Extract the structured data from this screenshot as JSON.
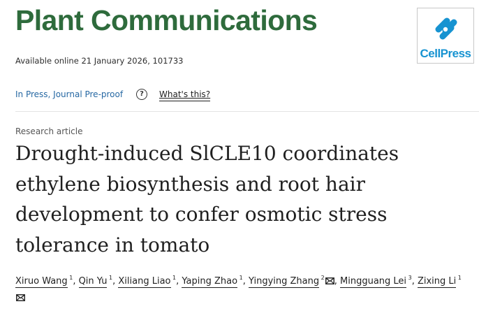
{
  "journal": {
    "name": "Plant Communications"
  },
  "publisher": {
    "logo_text": "CellPress",
    "logo_color": "#1793d1"
  },
  "article": {
    "availability": "Available online 21 January 2026, 101733",
    "press_status": "In Press, Journal Pre-proof",
    "help_icon_glyph": "?",
    "whats_this": "What's this?",
    "type": "Research article",
    "title": "Drought-induced SlCLE10 coordinates ethylene biosynthesis and root hair development to confer osmotic stress tolerance in tomato"
  },
  "authors": [
    {
      "name": "Xiruo Wang",
      "affil": "1",
      "email": false,
      "sep": ", "
    },
    {
      "name": "Qin Yu",
      "affil": "1",
      "email": false,
      "sep": ", "
    },
    {
      "name": "Xiliang Liao",
      "affil": "1",
      "email": false,
      "sep": ", "
    },
    {
      "name": "Yaping Zhao",
      "affil": "1",
      "email": false,
      "sep": ", "
    },
    {
      "name": "Yingying Zhang",
      "affil": "2",
      "email": true,
      "sep": ", "
    },
    {
      "name": "Mingguang Lei",
      "affil": "3",
      "email": false,
      "sep": ", "
    },
    {
      "name": "Zixing Li",
      "affil": "1",
      "email": true,
      "sep": ""
    }
  ],
  "colors": {
    "journal_green": "#2e6b3c",
    "link_blue": "#2668a3"
  }
}
